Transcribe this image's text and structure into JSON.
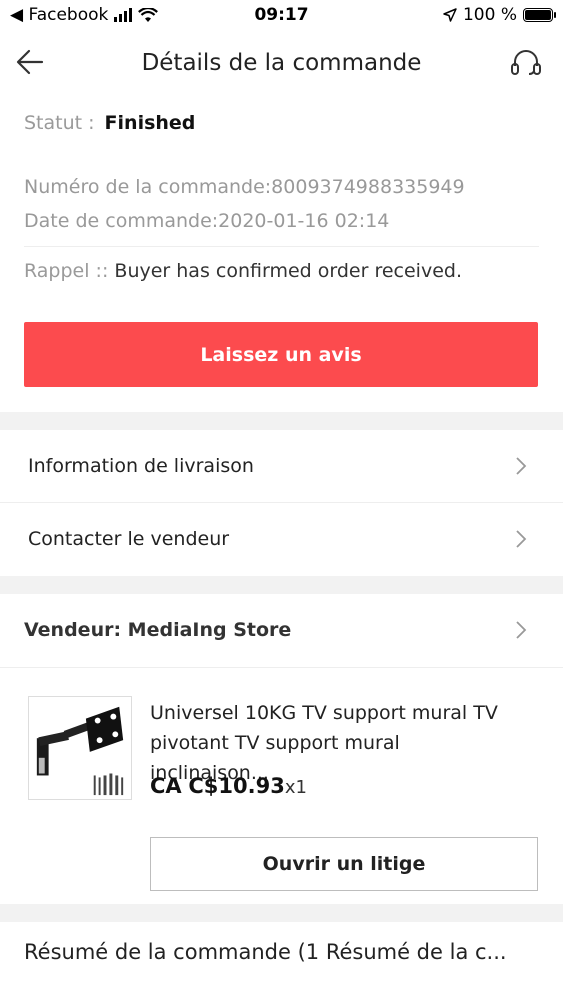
{
  "status_bar": {
    "back_app": "◀ Facebook",
    "time": "09:17",
    "battery_pct": "100 %"
  },
  "header": {
    "title": "Détails de la commande"
  },
  "order": {
    "status_label": "Statut :",
    "status_value": "Finished",
    "number_text": "Numéro de la commande:8009374988335949",
    "date_text": "Date de commande:2020-01-16 02:14",
    "reminder_label": "Rappel ::",
    "reminder_text": "Buyer has confirmed order received."
  },
  "review_button": "Laissez un avis",
  "rows": {
    "delivery": "Information de livraison",
    "contact": "Contacter le vendeur"
  },
  "seller": {
    "label": "Vendeur: MediaIng Store"
  },
  "product": {
    "title": "Universel 10KG TV support mural TV pivotant TV support mural inclinaison...",
    "price_prefix": "CA",
    "price": "C$10.93",
    "quantity": "x1"
  },
  "dispute_button": "Ouvrir un litige",
  "summary_text": "Résumé de la commande (1 Résumé de la c..."
}
